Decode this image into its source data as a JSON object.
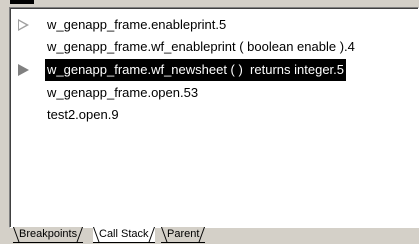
{
  "call_stack": {
    "rows": [
      {
        "label": "w_genapp_frame.enableprint.5",
        "marker": "hollow-arrow",
        "selected": false
      },
      {
        "label": "w_genapp_frame.wf_enableprint ( boolean enable ).4",
        "marker": "",
        "selected": false
      },
      {
        "label": "w_genapp_frame.wf_newsheet ( )  returns integer.5",
        "marker": "current-arrow",
        "selected": true
      },
      {
        "label": "w_genapp_frame.open.53",
        "marker": "",
        "selected": false
      },
      {
        "label": "test2.open.9",
        "marker": "",
        "selected": false
      }
    ]
  },
  "tabs": [
    {
      "label": "Breakpoints",
      "active": false
    },
    {
      "label": "Call Stack",
      "active": true
    },
    {
      "label": "Parent",
      "active": false
    }
  ]
}
